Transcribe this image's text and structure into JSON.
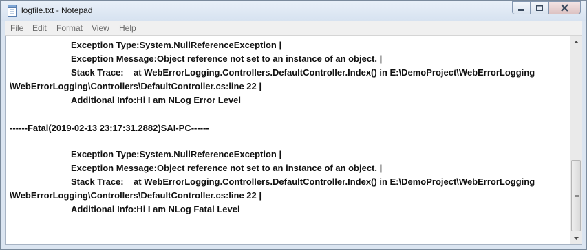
{
  "window": {
    "title": "logfile.txt - Notepad",
    "icon": "notepad-icon"
  },
  "controls": {
    "minimize": "minimize-icon",
    "maximize": "maximize-icon",
    "close": "close-icon"
  },
  "menu": {
    "items": [
      "File",
      "Edit",
      "Format",
      "View",
      "Help"
    ]
  },
  "content": {
    "lines": [
      "Exception Type:System.NullReferenceException |",
      "Exception Message:Object reference not set to an instance of an object. |",
      "Stack Trace:    at WebErrorLogging.Controllers.DefaultController.Index() in E:\\DemoProject\\WebErrorLogging",
      "\\WebErrorLogging\\Controllers\\DefaultController.cs:line 22 |",
      "Additional Info:Hi I am NLog Error Level",
      "------Fatal(2019-02-13 23:17:31.2882)SAI-PC------",
      "Exception Type:System.NullReferenceException |",
      "Exception Message:Object reference not set to an instance of an object. |",
      "Stack Trace:    at WebErrorLogging.Controllers.DefaultController.Index() in E:\\DemoProject\\WebErrorLogging",
      "\\WebErrorLogging\\Controllers\\DefaultController.cs:line 22 |",
      "Additional Info:Hi I am NLog Fatal Level"
    ]
  },
  "scrollbar": {
    "up_icon": "scroll-up-arrow-icon",
    "down_icon": "scroll-down-arrow-icon"
  }
}
